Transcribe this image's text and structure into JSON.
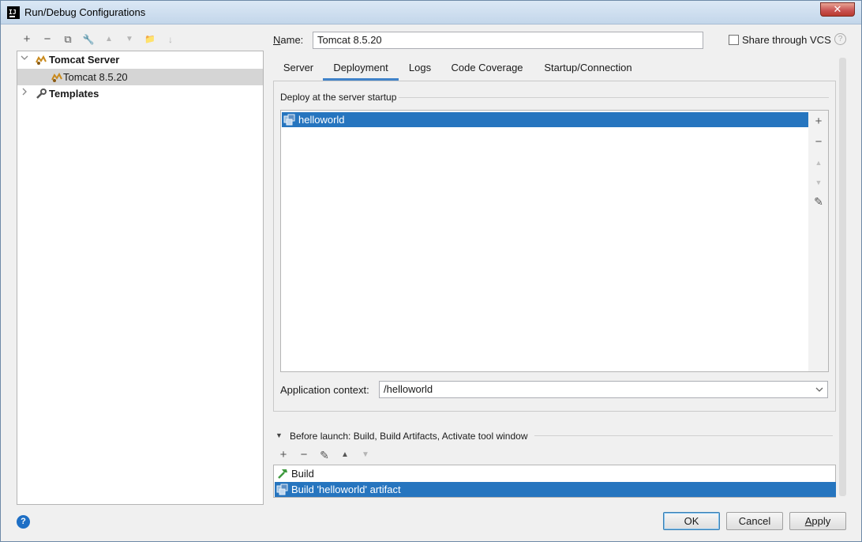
{
  "window": {
    "title": "Run/Debug Configurations",
    "close_glyph": "✕"
  },
  "left_toolbar": {
    "add": "+",
    "remove": "−",
    "copy": "⧉",
    "edit_defaults": "🔧",
    "move_up": "▲",
    "move_down": "▼",
    "folder": "📁",
    "sort": "↓"
  },
  "tree": {
    "items": [
      {
        "label": "Tomcat Server",
        "expanded": true,
        "bold": true
      },
      {
        "label": "Tomcat 8.5.20",
        "selected": true
      },
      {
        "label": "Templates",
        "expanded": false,
        "bold": true
      }
    ]
  },
  "config": {
    "name_label": "Name:",
    "name_value": "Tomcat 8.5.20",
    "share_label": "Share through VCS",
    "share_checked": false,
    "help_glyph": "?"
  },
  "tabs": [
    {
      "label": "Server"
    },
    {
      "label": "Deployment",
      "active": true
    },
    {
      "label": "Logs"
    },
    {
      "label": "Code Coverage"
    },
    {
      "label": "Startup/Connection"
    }
  ],
  "deployment": {
    "group_title": "Deploy at the server startup",
    "artifacts": [
      {
        "label": "helloworld",
        "selected": true
      }
    ],
    "side_buttons": {
      "add": "+",
      "remove": "−",
      "up": "▲",
      "down": "▼",
      "edit": "✎"
    },
    "context_label": "Application context:",
    "context_value": "/helloworld"
  },
  "before_launch": {
    "label": "Before launch: Build, Build Artifacts, Activate tool window",
    "toolbar": {
      "add": "+",
      "remove": "−",
      "edit": "✎",
      "up": "▲",
      "down": "▼"
    },
    "tasks": [
      {
        "label": "Build"
      },
      {
        "label": "Build 'helloworld' artifact",
        "selected": true
      }
    ]
  },
  "buttons": {
    "help": "?",
    "ok": "OK",
    "cancel": "Cancel",
    "apply": "Apply"
  },
  "colors": {
    "selection": "#2675bf",
    "tab_underline": "#4083c9"
  }
}
